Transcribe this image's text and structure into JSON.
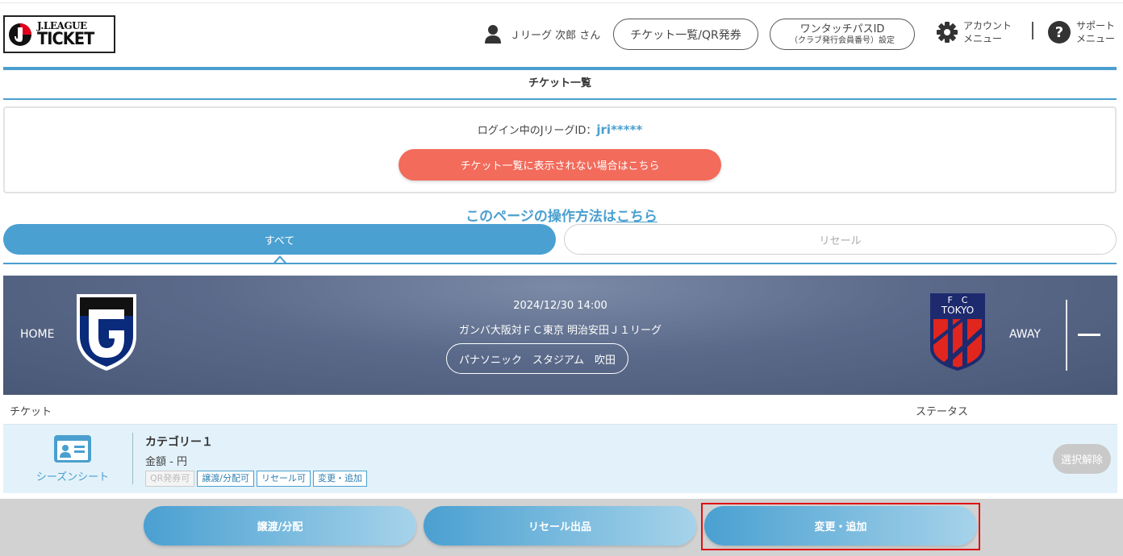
{
  "header": {
    "logo_line1": "J.LEAGUE",
    "logo_line2": "TICKET",
    "user_name": "Ｊリーグ 次郎 さん",
    "tickets_button": "チケット一覧/QR発券",
    "onetouch_line1": "ワンタッチパスID",
    "onetouch_line2": "（クラブ発行会員番号）設定",
    "account_line1": "アカウント",
    "account_line2": "メニュー",
    "support_line1": "サポート",
    "support_line2": "メニュー"
  },
  "section_title": "チケット一覧",
  "login": {
    "label": "ログイン中のJリーグID：",
    "id": "jri*****",
    "not_shown_button": "チケット一覧に表示されない場合はこちら"
  },
  "howto": {
    "text": "このページの操作方法は",
    "link": "こちら"
  },
  "tabs": [
    {
      "label": "すべて",
      "active": true
    },
    {
      "label": "リセール",
      "active": false
    }
  ],
  "match": {
    "home_label": "HOME",
    "away_label": "AWAY",
    "datetime": "2024/12/30 14:00",
    "title": "ガンバ大阪対ＦＣ東京 明治安田Ｊ１リーグ",
    "venue": "パナソニック　スタジアム　吹田",
    "away_logo_text_top": "F　C",
    "away_logo_text": "TOKYO"
  },
  "columns": {
    "ticket": "チケット",
    "status": "ステータス"
  },
  "ticket": {
    "type": "シーズンシート",
    "category": "カテゴリー１",
    "price": "金額 - 円",
    "tags": [
      {
        "label": "QR発券可",
        "enabled": false
      },
      {
        "label": "譲渡/分配可",
        "enabled": true
      },
      {
        "label": "リセール可",
        "enabled": true
      },
      {
        "label": "変更・追加",
        "enabled": true
      }
    ],
    "deselect_button": "選択解除"
  },
  "actions": {
    "transfer": "譲渡/分配",
    "resale": "リセール出品",
    "change": "変更・追加"
  },
  "colors": {
    "accent": "#4a9fcf",
    "alert": "#f26b5b",
    "match_bg": "#5b6a8a",
    "highlight": "#e01010"
  }
}
